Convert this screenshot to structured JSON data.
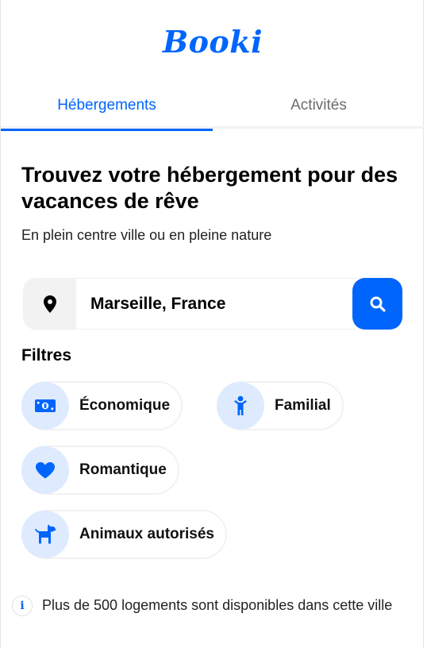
{
  "brand": {
    "logo": "Booki",
    "accent": "#0065fc",
    "chip_icon_bg": "#deebff"
  },
  "tabs": [
    {
      "label": "Hébergements",
      "active": true
    },
    {
      "label": "Activités",
      "active": false
    }
  ],
  "hero": {
    "title": "Trouvez votre hébergement pour des vacances de rêve",
    "subtitle": "En plein centre ville ou en pleine nature"
  },
  "search": {
    "value": "Marseille, France",
    "location_icon": "map-pin-icon",
    "button_icon": "search-icon"
  },
  "filters": {
    "title": "Filtres",
    "items": [
      {
        "label": "Économique",
        "icon": "money-icon"
      },
      {
        "label": "Familial",
        "icon": "child-icon"
      },
      {
        "label": "Romantique",
        "icon": "heart-icon"
      },
      {
        "label": "Animaux autorisés",
        "icon": "dog-icon"
      }
    ]
  },
  "info": {
    "icon": "info-icon",
    "icon_glyph": "i",
    "text": "Plus de 500 logements sont disponibles dans cette ville"
  }
}
